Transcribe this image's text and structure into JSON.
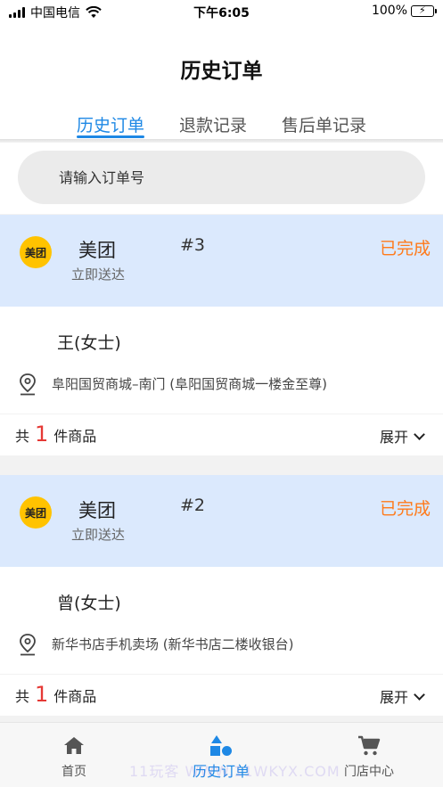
{
  "status_bar": {
    "carrier": "中国电信",
    "time": "下午6:05",
    "battery": "100%"
  },
  "header": {
    "title": "历史订单",
    "tabs": [
      {
        "label": "历史订单",
        "active": true
      },
      {
        "label": "退款记录",
        "active": false
      },
      {
        "label": "售后单记录",
        "active": false
      }
    ]
  },
  "search": {
    "placeholder": "请输入订单号"
  },
  "orders": [
    {
      "platform": "美团",
      "logo_text": "美团",
      "delivery": "立即送达",
      "number": "#3",
      "status": "已完成",
      "customer": "王(女士)",
      "address": "阜阳国贸商城–南门 (阜阳国贸商城一楼金至尊)",
      "count_prefix": "共",
      "count": "1",
      "count_suffix": "件商品",
      "expand_label": "展开"
    },
    {
      "platform": "美团",
      "logo_text": "美团",
      "delivery": "立即送达",
      "number": "#2",
      "status": "已完成",
      "customer": "曾(女士)",
      "address": "新华书店手机卖场 (新华书店二楼收银台)",
      "count_prefix": "共",
      "count": "1",
      "count_suffix": "件商品",
      "expand_label": "展开"
    }
  ],
  "bottom_nav": {
    "items": [
      {
        "label": "首页",
        "icon": "home-icon"
      },
      {
        "label": "历史订单",
        "icon": "shapes-icon",
        "active": true
      },
      {
        "label": "门店中心",
        "icon": "cart-icon"
      }
    ],
    "watermark": "11玩客 WWW.11WKYX.COM"
  },
  "colors": {
    "accent": "#1e88e5",
    "status": "#ff7a1a",
    "count": "#e53935",
    "card_header": "#dbe9fd",
    "logo": "#ffc300"
  }
}
